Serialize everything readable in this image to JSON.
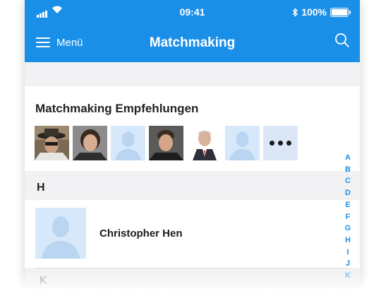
{
  "status_bar": {
    "time": "09:41",
    "battery": "100%"
  },
  "nav": {
    "menu_label": "Menü",
    "title": "Matchmaking"
  },
  "recommendations": {
    "title": "Matchmaking Empfehlungen",
    "avatars": [
      {
        "kind": "photo",
        "icon": "hat-man-photo"
      },
      {
        "kind": "photo",
        "icon": "woman-photo"
      },
      {
        "kind": "placeholder",
        "icon": "person-placeholder-icon"
      },
      {
        "kind": "photo",
        "icon": "smiling-man-photo"
      },
      {
        "kind": "photo",
        "icon": "suit-man-photo"
      },
      {
        "kind": "placeholder",
        "icon": "person-placeholder-icon"
      }
    ],
    "more_icon": "ellipsis-icon"
  },
  "sections": [
    {
      "letter": "H",
      "rows": [
        {
          "name": "Christopher Hen"
        }
      ]
    },
    {
      "letter": "K",
      "rows": []
    }
  ],
  "alphabet": [
    "A",
    "B",
    "C",
    "D",
    "E",
    "F",
    "G",
    "H",
    "I",
    "J",
    "K"
  ],
  "colors": {
    "accent": "#1a8fe8",
    "background": "#f2f2f4",
    "placeholder_avatar": "#d6e8f9",
    "more_button": "#dbe7f6"
  }
}
